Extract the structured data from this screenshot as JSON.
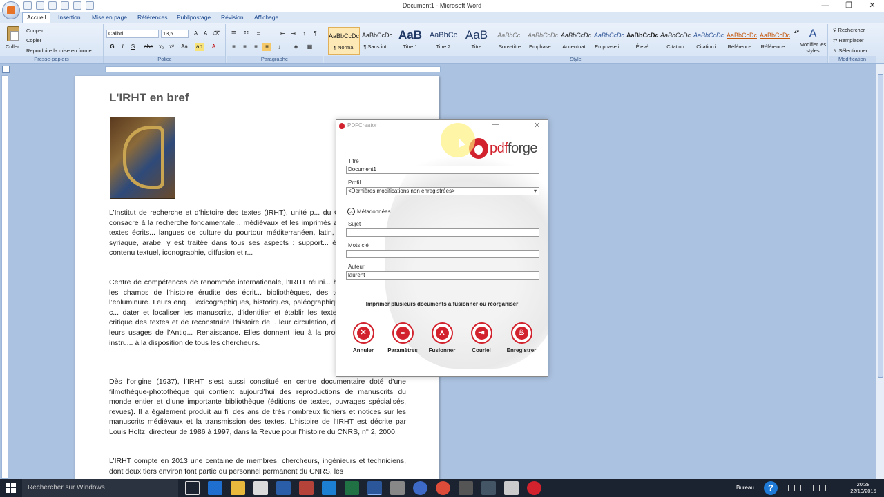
{
  "window": {
    "title": "Document1 - Microsoft Word",
    "controls": [
      "—",
      "❐",
      "✕"
    ]
  },
  "ribbon": {
    "tabs": [
      "Accueil",
      "Insertion",
      "Mise en page",
      "Références",
      "Publipostage",
      "Révision",
      "Affichage"
    ],
    "clipboard": {
      "paste": "Coller",
      "cut": "Couper",
      "copy": "Copier",
      "format_painter": "Reproduire la mise en forme",
      "label": "Presse-papiers"
    },
    "font": {
      "name": "Calibri",
      "size": "13,5",
      "label": "Police",
      "buttons": [
        "G",
        "I",
        "S",
        "abe",
        "x₂",
        "x²",
        "Aa",
        "A"
      ]
    },
    "paragraph": {
      "label": "Paragraphe"
    },
    "styles": {
      "label": "Style",
      "items": [
        {
          "sample": "AaBbCcDc",
          "name": "¶ Normal"
        },
        {
          "sample": "AaBbCcDc",
          "name": "¶ Sans int..."
        },
        {
          "sample": "AaB",
          "name": "Titre 1"
        },
        {
          "sample": "AaBbCc",
          "name": "Titre 2"
        },
        {
          "sample": "AaB",
          "name": "Titre"
        },
        {
          "sample": "AaBbCc.",
          "name": "Sous-titre"
        },
        {
          "sample": "AaBbCcDc",
          "name": "Emphase ..."
        },
        {
          "sample": "AaBbCcDc",
          "name": "Accentuat..."
        },
        {
          "sample": "AaBbCcDc",
          "name": "Emphase i..."
        },
        {
          "sample": "AaBbCcDc",
          "name": "Élevé"
        },
        {
          "sample": "AaBbCcDc",
          "name": "Citation"
        },
        {
          "sample": "AaBbCcDc",
          "name": "Citation i..."
        },
        {
          "sample": "AaBbCcDc",
          "name": "Référence..."
        },
        {
          "sample": "AaBbCcDc",
          "name": "Référence..."
        }
      ],
      "modify": "Modifier les styles"
    },
    "editing": {
      "label": "Modification",
      "find": "Rechercher",
      "replace": "Remplacer",
      "select": "Sélectionner"
    }
  },
  "document": {
    "title": "L'IRHT en bref",
    "paragraphs": [
      "L’Institut de recherche et d’histoire des textes (IRHT), unité p... du CNRS (UPR 841), se consacre à la recherche fondamentale... médiévaux et les imprimés anciens. L’histoire des textes écrits... langues de culture du pourtour méditerranéen, latin, langues ron... copte, syriaque, arabe, y est traitée dans tous ses aspects : support... écriture et décoration, contenu textuel, iconographie, diffusion et r...",
      "Centre de compétences de renommée internationale, l’IRHT réuni... haut niveau dans tous les champs de l’histoire érudite des écrit... bibliothèques, des textes et de l’art de l’enluminure. Leurs enq... lexicographiques, historiques, paléographiques et codicologiques c... dater et localiser les manuscrits, d’identifier et établir les textes... préparer l’édition critique des textes et de reconstruire l’histoire de... leur circulation, de leur audience et de leurs usages de l’Antiq... Renaissance. Elles donnent lieu à la production de nombreux instru... à la disposition de tous les chercheurs.",
      "Dès l’origine (1937), l’IRHT s’est aussi constitué en centre documentaire doté d’une filmothèque-photothèque qui contient aujourd’hui des reproductions de manuscrits du monde entier et d’une importante bibliothèque (éditions de textes, ouvrages spécialisés, revues). Il a également produit au fil des ans de très nombreux fichiers et notices sur les manuscrits médiévaux et la transmission des textes. L’histoire de l’IRHT est décrite par Louis Holtz, directeur de 1986 à 1997, dans la Revue pour l’histoire du CNRS, n° 2, 2000.",
      "L’IRHT compte en 2013 une centaine de membres, chercheurs, ingénieurs et techniciens, dont deux tiers environ font partie du personnel permanent du CNRS, les"
    ]
  },
  "pdfcreator": {
    "title": "PDFCreator",
    "logo_text_a": "pdf",
    "logo_text_b": "forge",
    "fields": {
      "titre_label": "Titre",
      "titre_value": "Document1",
      "profil_label": "Profil",
      "profil_value": "<Dernières modifications non enregistrées>",
      "metadata_toggle": "Métadonnées",
      "sujet_label": "Sujet",
      "sujet_value": "",
      "motscle_label": "Mots clé",
      "motscle_value": "",
      "auteur_label": "Auteur",
      "auteur_value": "laurent"
    },
    "hint": "Imprimer plusieurs documents à fusionner ou réorganiser",
    "actions": [
      {
        "label": "Annuler",
        "icon": "✕"
      },
      {
        "label": "Paramètres",
        "icon": "≡"
      },
      {
        "label": "Fusionner",
        "icon": "⋏"
      },
      {
        "label": "Couriel",
        "icon": "⇥"
      },
      {
        "label": "Enregistrer",
        "icon": "♨"
      }
    ]
  },
  "taskbar": {
    "search_placeholder": "Rechercher sur Windows",
    "tray_label": "Bureau",
    "time": "20:28",
    "date": "22/10/2015"
  },
  "colors": {
    "pdf_red": "#d2222d",
    "ribbon_blue": "#d5e3f4",
    "doc_background": "#abc2e0",
    "taskbar": "#1c2330"
  }
}
